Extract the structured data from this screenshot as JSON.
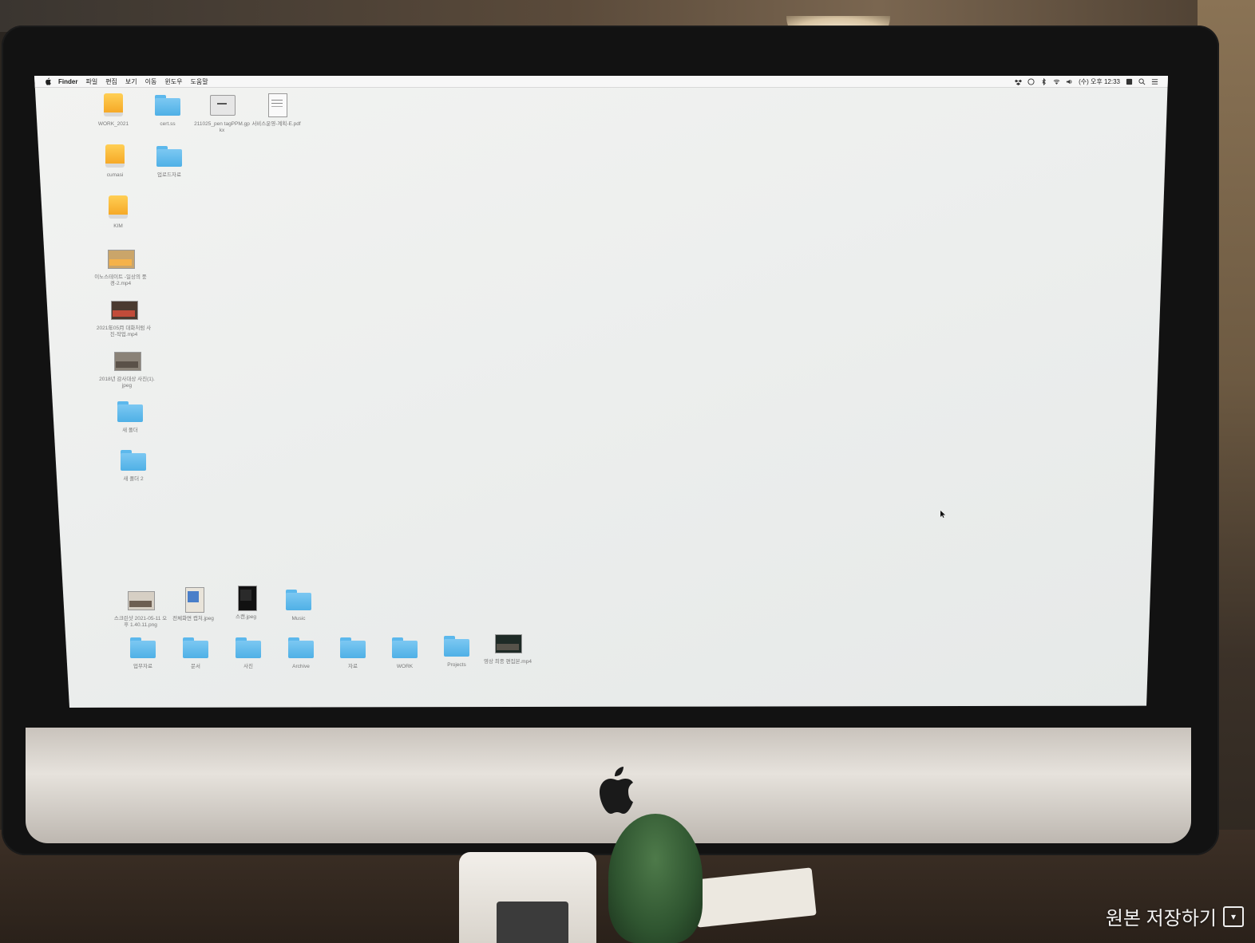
{
  "menubar": {
    "app_name": "Finder",
    "menus": [
      "파일",
      "편집",
      "보기",
      "이동",
      "윈도우",
      "도움말"
    ],
    "clock": "(수) 오후 12:33"
  },
  "desktop_icons": [
    {
      "id": "work2021",
      "label": "WORK_2021",
      "kind": "drive"
    },
    {
      "id": "f_top2",
      "label": "cert.ss",
      "kind": "folder"
    },
    {
      "id": "gpx",
      "label": "211025_pen tagPPM.gpkx",
      "kind": "doc"
    },
    {
      "id": "pdf1",
      "label": "서비스운영-계획-E.pdf",
      "kind": "pdf"
    },
    {
      "id": "drive2",
      "label": "cumasi",
      "kind": "drive"
    },
    {
      "id": "f_row2",
      "label": "업로드자료",
      "kind": "folder"
    },
    {
      "id": "drive3",
      "label": "KIM",
      "kind": "drive"
    },
    {
      "id": "mov1",
      "label": "이노스테이트 -일상의 풍경-2.mp4",
      "kind": "thumb"
    },
    {
      "id": "mov2",
      "label": "2021年05月 대화처럼 사진-작업.mp4",
      "kind": "thumb"
    },
    {
      "id": "img1",
      "label": "2018년 감사대상 사진(1).jpeg",
      "kind": "thumb"
    },
    {
      "id": "f_left1",
      "label": "새 폴더",
      "kind": "folder"
    },
    {
      "id": "f_left2",
      "label": "새 폴더 2",
      "kind": "folder"
    },
    {
      "id": "b1",
      "label": "스크린샷 2021-05-11 오후 1.40.11.png",
      "kind": "thumb"
    },
    {
      "id": "b2",
      "label": "전체화면 캡처.jpeg",
      "kind": "thumb"
    },
    {
      "id": "b3",
      "label": "스캔.jpeg",
      "kind": "thumb"
    },
    {
      "id": "b4",
      "label": "Music",
      "kind": "folder"
    },
    {
      "id": "c1",
      "label": "업무자료",
      "kind": "folder"
    },
    {
      "id": "c2",
      "label": "문서",
      "kind": "folder"
    },
    {
      "id": "c3",
      "label": "사진",
      "kind": "folder"
    },
    {
      "id": "c4",
      "label": "Archive",
      "kind": "folder"
    },
    {
      "id": "c5",
      "label": "자료",
      "kind": "folder"
    },
    {
      "id": "c6",
      "label": "WORK",
      "kind": "folder"
    },
    {
      "id": "c7",
      "label": "Projects",
      "kind": "folder"
    },
    {
      "id": "c8",
      "label": "영상 최종 편집본.mp4",
      "kind": "thumb"
    }
  ],
  "overlay": {
    "save_label": "원본 저장하기"
  },
  "colors": {
    "folder": "#5cb8ec",
    "drive": "#f5a623",
    "desktop": "#eceeed"
  }
}
